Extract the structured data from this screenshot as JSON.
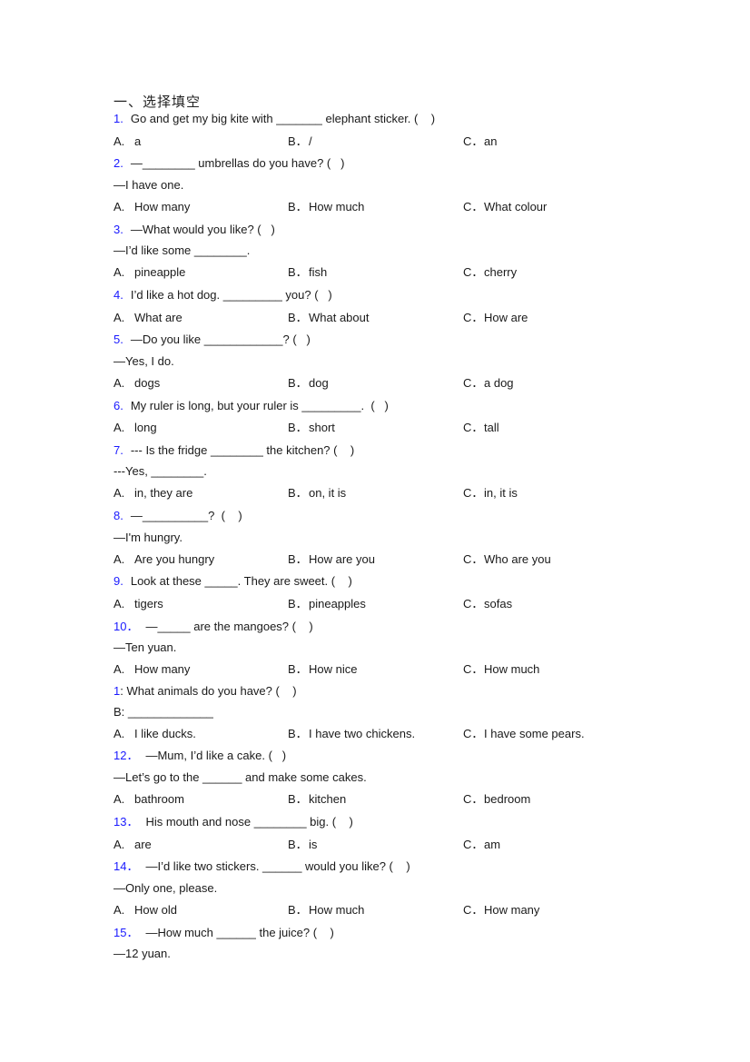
{
  "section_title": "一、选择填空",
  "questions": [
    {
      "num": "1.",
      "stem": [
        "Go and get my big kite with _______ elephant sticker. (    )"
      ],
      "options": [
        "a",
        "/",
        "an"
      ]
    },
    {
      "num": "2.",
      "stem": [
        "—________ umbrellas do you have? (   )",
        "—I have one."
      ],
      "options": [
        "How many",
        "How much",
        "What colour"
      ]
    },
    {
      "num": "3.",
      "stem": [
        "—What would you like? (   )",
        "—I’d like some ________."
      ],
      "options": [
        "pineapple",
        "fish",
        "cherry"
      ]
    },
    {
      "num": "4.",
      "stem": [
        "I’d like a hot dog. _________ you? (   )"
      ],
      "options": [
        "What are",
        "What about",
        "How are"
      ]
    },
    {
      "num": "5.",
      "stem": [
        "—Do you like ____________? (   )",
        "—Yes, I do."
      ],
      "options": [
        "dogs",
        "dog",
        "a dog"
      ]
    },
    {
      "num": "6.",
      "stem": [
        "My ruler is long, but your ruler is _________.  (   )"
      ],
      "options": [
        "long",
        "short",
        "tall"
      ]
    },
    {
      "num": "7.",
      "stem": [
        "--- Is the fridge ________ the kitchen? (    )",
        "---Yes, ________."
      ],
      "options": [
        "in, they are",
        "on, it is",
        "in, it is"
      ]
    },
    {
      "num": "8.",
      "stem": [
        "—__________?  (    )",
        "—I'm hungry."
      ],
      "options": [
        "Are you hungry",
        "How are you",
        "Who are you"
      ]
    },
    {
      "num": "9.",
      "stem": [
        "Look at these _____. They are sweet. (    )"
      ],
      "options": [
        "tigers",
        "pineapples",
        "sofas"
      ]
    },
    {
      "num": "10．",
      "stem": [
        "—_____ are the mangoes? (    )",
        "—Ten yuan."
      ],
      "options": [
        "How many",
        "How nice",
        "How much"
      ]
    },
    {
      "num": "1",
      "num_suffix": ": What animals do you have? (    )",
      "stem": [
        "B: _____________"
      ],
      "options": [
        "I like ducks.",
        "I have two chickens.",
        "I have some pears."
      ]
    },
    {
      "num": "12．",
      "stem": [
        "—Mum, I’d like a cake. (   )",
        "—Let’s go to the ______ and make some cakes."
      ],
      "options": [
        "bathroom",
        "kitchen",
        "bedroom"
      ]
    },
    {
      "num": "13．",
      "stem": [
        "His mouth and nose ________ big. (    )"
      ],
      "options": [
        "are",
        "is",
        "am"
      ]
    },
    {
      "num": "14．",
      "stem": [
        "—I’d like two stickers. ______ would you like? (    )",
        "—Only one, please."
      ],
      "options": [
        "How old",
        "How much",
        "How many"
      ]
    },
    {
      "num": "15．",
      "stem": [
        "—How much ______ the juice? (    )",
        "—12 yuan."
      ],
      "options": []
    }
  ],
  "option_letters": [
    "A.",
    "B．",
    "C．"
  ],
  "colors": {
    "number_blue": "#1a1aff",
    "text": "#1a1a1a"
  }
}
